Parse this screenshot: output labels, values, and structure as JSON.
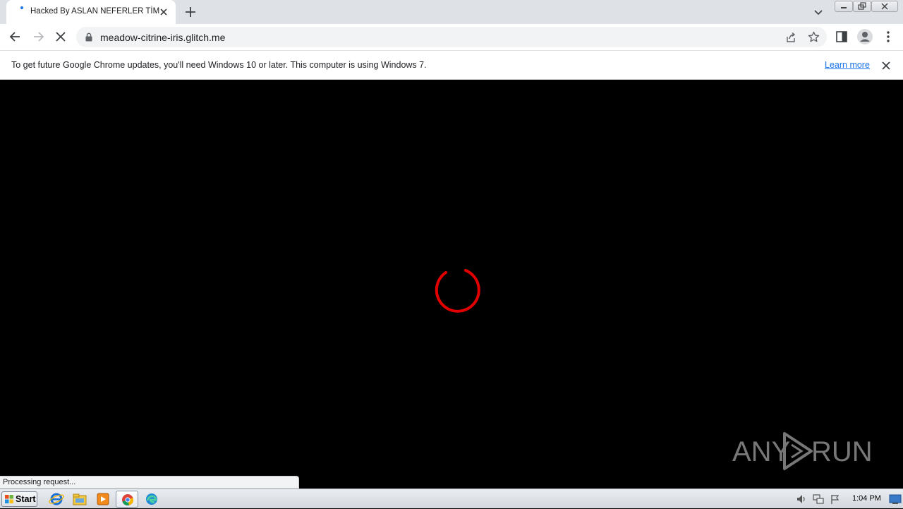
{
  "browser": {
    "tab": {
      "title": "Hacked By ASLAN NEFERLER TİM"
    },
    "address": {
      "url": "meadow-citrine-iris.glitch.me"
    },
    "infobar": {
      "message": "To get future Google Chrome updates, you'll need Windows 10 or later. This computer is using Windows 7.",
      "link": "Learn more"
    },
    "status": "Processing request..."
  },
  "page": {
    "background": "#000000",
    "spinner_color": "#e00000"
  },
  "watermark": {
    "left": "ANY",
    "right": "RUN"
  },
  "taskbar": {
    "start_label": "Start",
    "apps": [
      "internet-explorer-icon",
      "file-explorer-icon",
      "media-player-icon",
      "chrome-icon",
      "edge-icon"
    ],
    "clock": "1:04 PM"
  }
}
